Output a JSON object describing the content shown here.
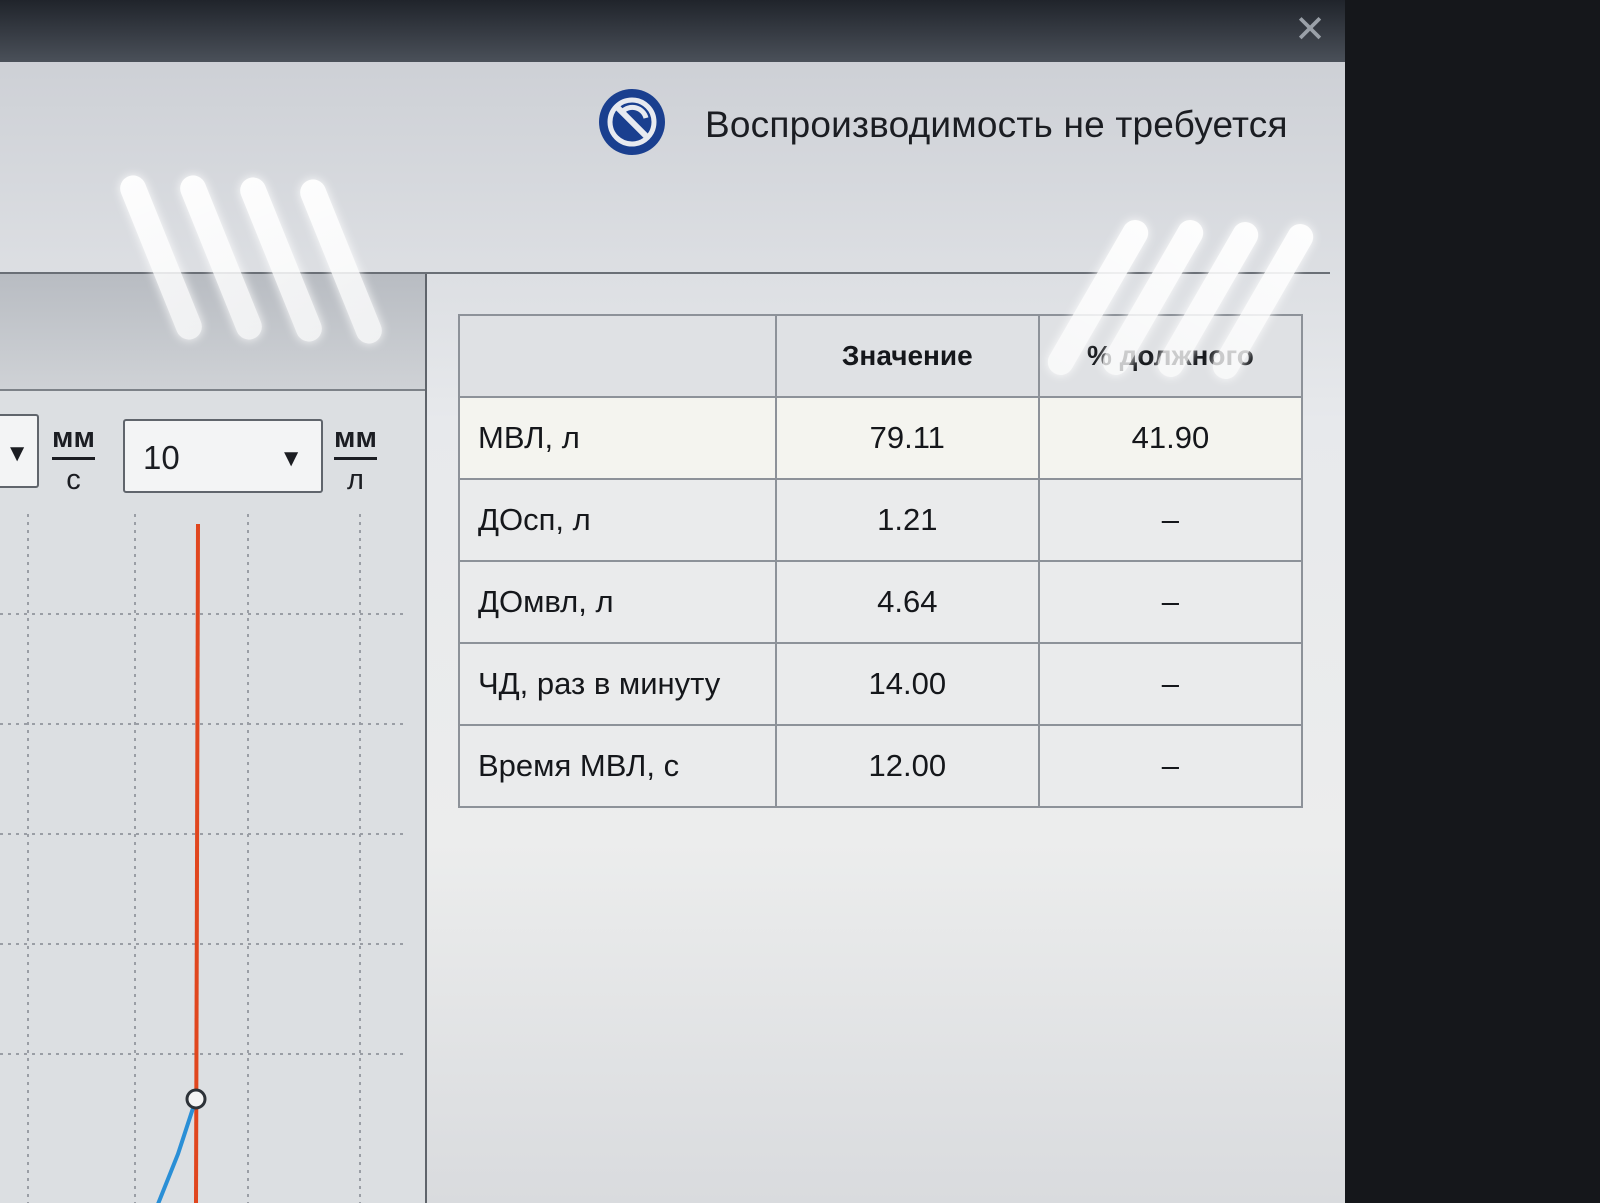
{
  "window": {
    "close_label": "✕"
  },
  "status": {
    "text": "Воспроизводимость не требуется",
    "icon": "not-required-icon"
  },
  "controls": {
    "left_unit": {
      "numerator": "мм",
      "denominator": "с"
    },
    "scale_select": {
      "value": "10"
    },
    "right_unit": {
      "numerator": "мм",
      "denominator": "л"
    }
  },
  "results_table": {
    "headers": [
      "",
      "Значение",
      "% должного"
    ],
    "rows": [
      {
        "label": "МВЛ, л",
        "value": "79.11",
        "percent": "41.90"
      },
      {
        "label": "ДОсп, л",
        "value": "1.21",
        "percent": "–"
      },
      {
        "label": "ДОмвл, л",
        "value": "4.64",
        "percent": "–"
      },
      {
        "label": "ЧД, раз в минуту",
        "value": "14.00",
        "percent": "–"
      },
      {
        "label": "Время МВЛ, с",
        "value": "12.00",
        "percent": "–"
      }
    ]
  },
  "colors": {
    "marker_line": "#e0461e",
    "curve": "#2a8fd6",
    "grid": "#9a9ea5"
  }
}
